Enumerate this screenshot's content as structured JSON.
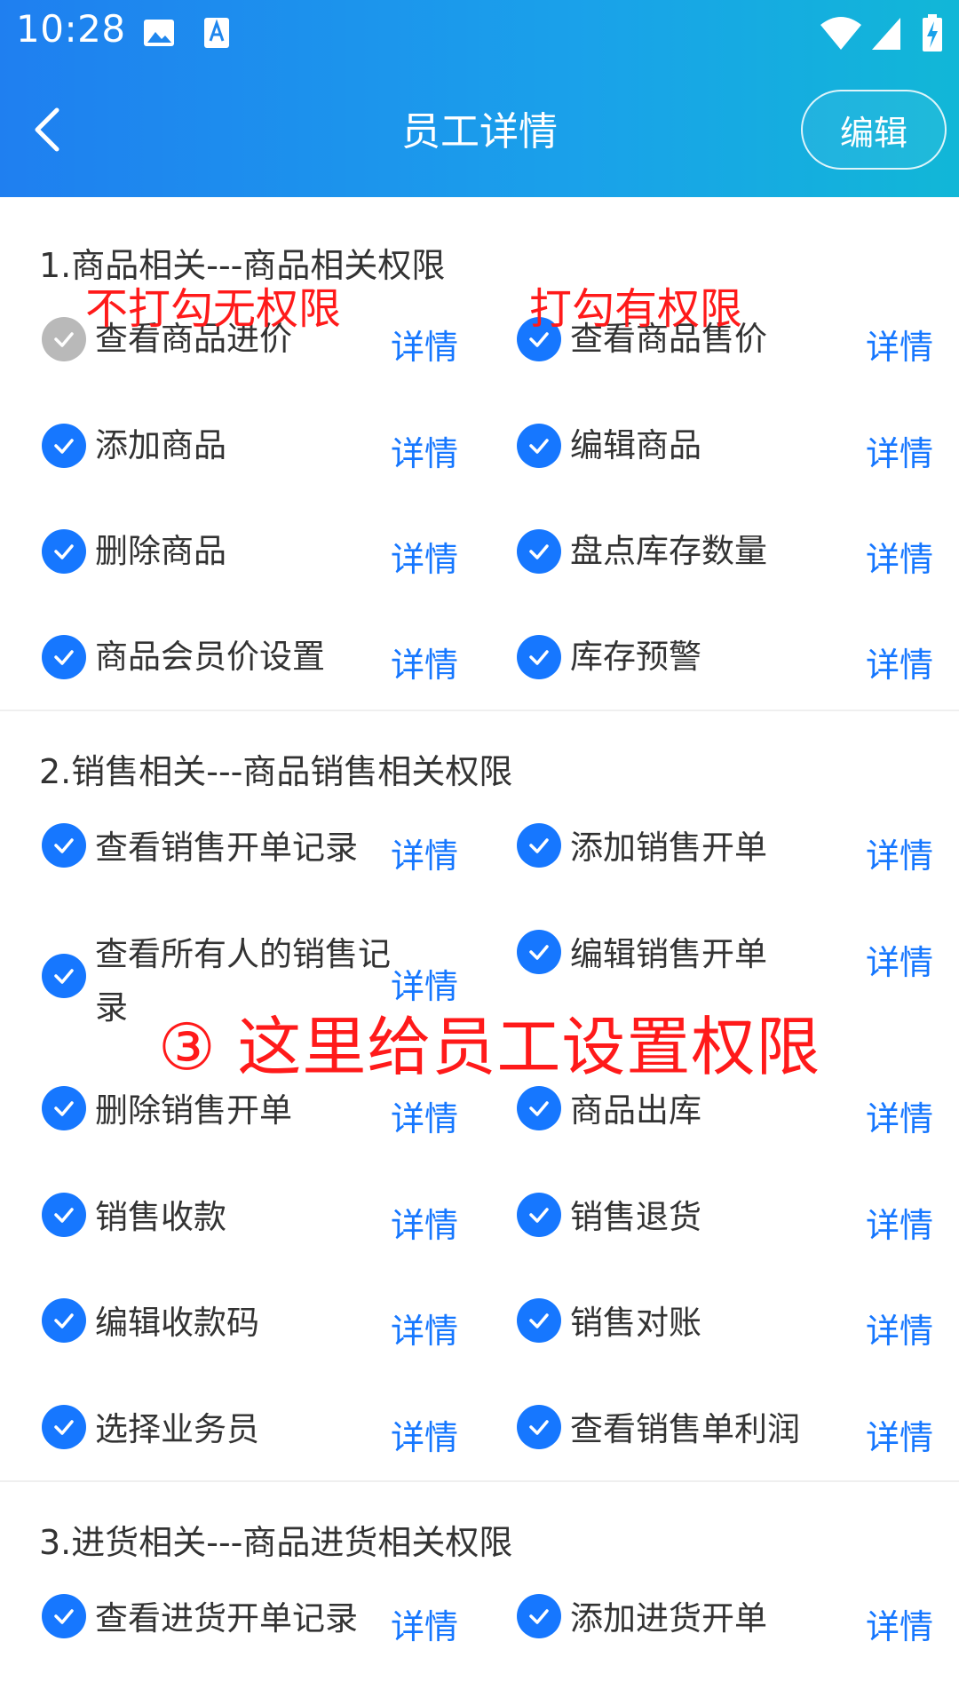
{
  "status": {
    "time": "10:28"
  },
  "header": {
    "title": "员工详情",
    "edit_label": "编辑"
  },
  "sections": [
    {
      "title": "1.商品相关---商品相关权限",
      "items": [
        {
          "label": "查看商品进价",
          "checked": false
        },
        {
          "label": "查看商品售价",
          "checked": true
        },
        {
          "label": "添加商品",
          "checked": true
        },
        {
          "label": "编辑商品",
          "checked": true
        },
        {
          "label": "删除商品",
          "checked": true
        },
        {
          "label": "盘点库存数量",
          "checked": true
        },
        {
          "label": "商品会员价设置",
          "checked": true
        },
        {
          "label": "库存预警",
          "checked": true
        }
      ]
    },
    {
      "title": "2.销售相关---商品销售相关权限",
      "items": [
        {
          "label": "查看销售开单记录",
          "checked": true
        },
        {
          "label": "添加销售开单",
          "checked": true
        },
        {
          "label": "查看所有人的销售记录",
          "checked": true
        },
        {
          "label": "编辑销售开单",
          "checked": true
        },
        {
          "label": "删除销售开单",
          "checked": true
        },
        {
          "label": "商品出库",
          "checked": true
        },
        {
          "label": "销售收款",
          "checked": true
        },
        {
          "label": "销售退货",
          "checked": true
        },
        {
          "label": "编辑收款码",
          "checked": true
        },
        {
          "label": "销售对账",
          "checked": true
        },
        {
          "label": "选择业务员",
          "checked": true
        },
        {
          "label": "查看销售单利润",
          "checked": true
        }
      ]
    },
    {
      "title": "3.进货相关---商品进货相关权限",
      "items": [
        {
          "label": "查看进货开单记录",
          "checked": true
        },
        {
          "label": "添加进货开单",
          "checked": true
        }
      ]
    }
  ],
  "detail_label": "详情",
  "annotations": {
    "unchecked_note": "不打勾无权限",
    "checked_note": "打勾有权限",
    "main_note": "③ 这里给员工设置权限"
  },
  "colors": {
    "accent": "#1677ff",
    "annotation": "#ff1a1a",
    "header_start": "#1f7ff0",
    "header_end": "#11b7d7"
  }
}
